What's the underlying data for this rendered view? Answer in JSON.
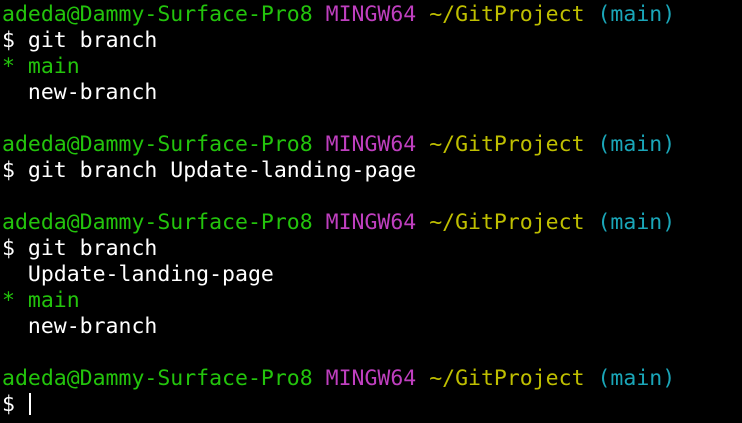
{
  "prompt": {
    "user_host": "adeda@Dammy-Surface-Pro8",
    "system": "MINGW64",
    "path": "~/GitProject",
    "branch": "(main)",
    "symbol": "$"
  },
  "commands": {
    "cmd1": "git branch",
    "cmd2": "git branch Update-landing-page",
    "cmd3": "git branch"
  },
  "output1": {
    "current_marker": "*",
    "current_branch": "main",
    "other_branch": "new-branch"
  },
  "output3": {
    "branch_a": "Update-landing-page",
    "current_marker": "*",
    "current_branch": "main",
    "branch_c": "new-branch"
  },
  "colors": {
    "background": "#000000",
    "user_host": "#23c40c",
    "system": "#bf3fbf",
    "path": "#bfbf00",
    "branch": "#1aa6b8",
    "text": "#ffffff"
  }
}
